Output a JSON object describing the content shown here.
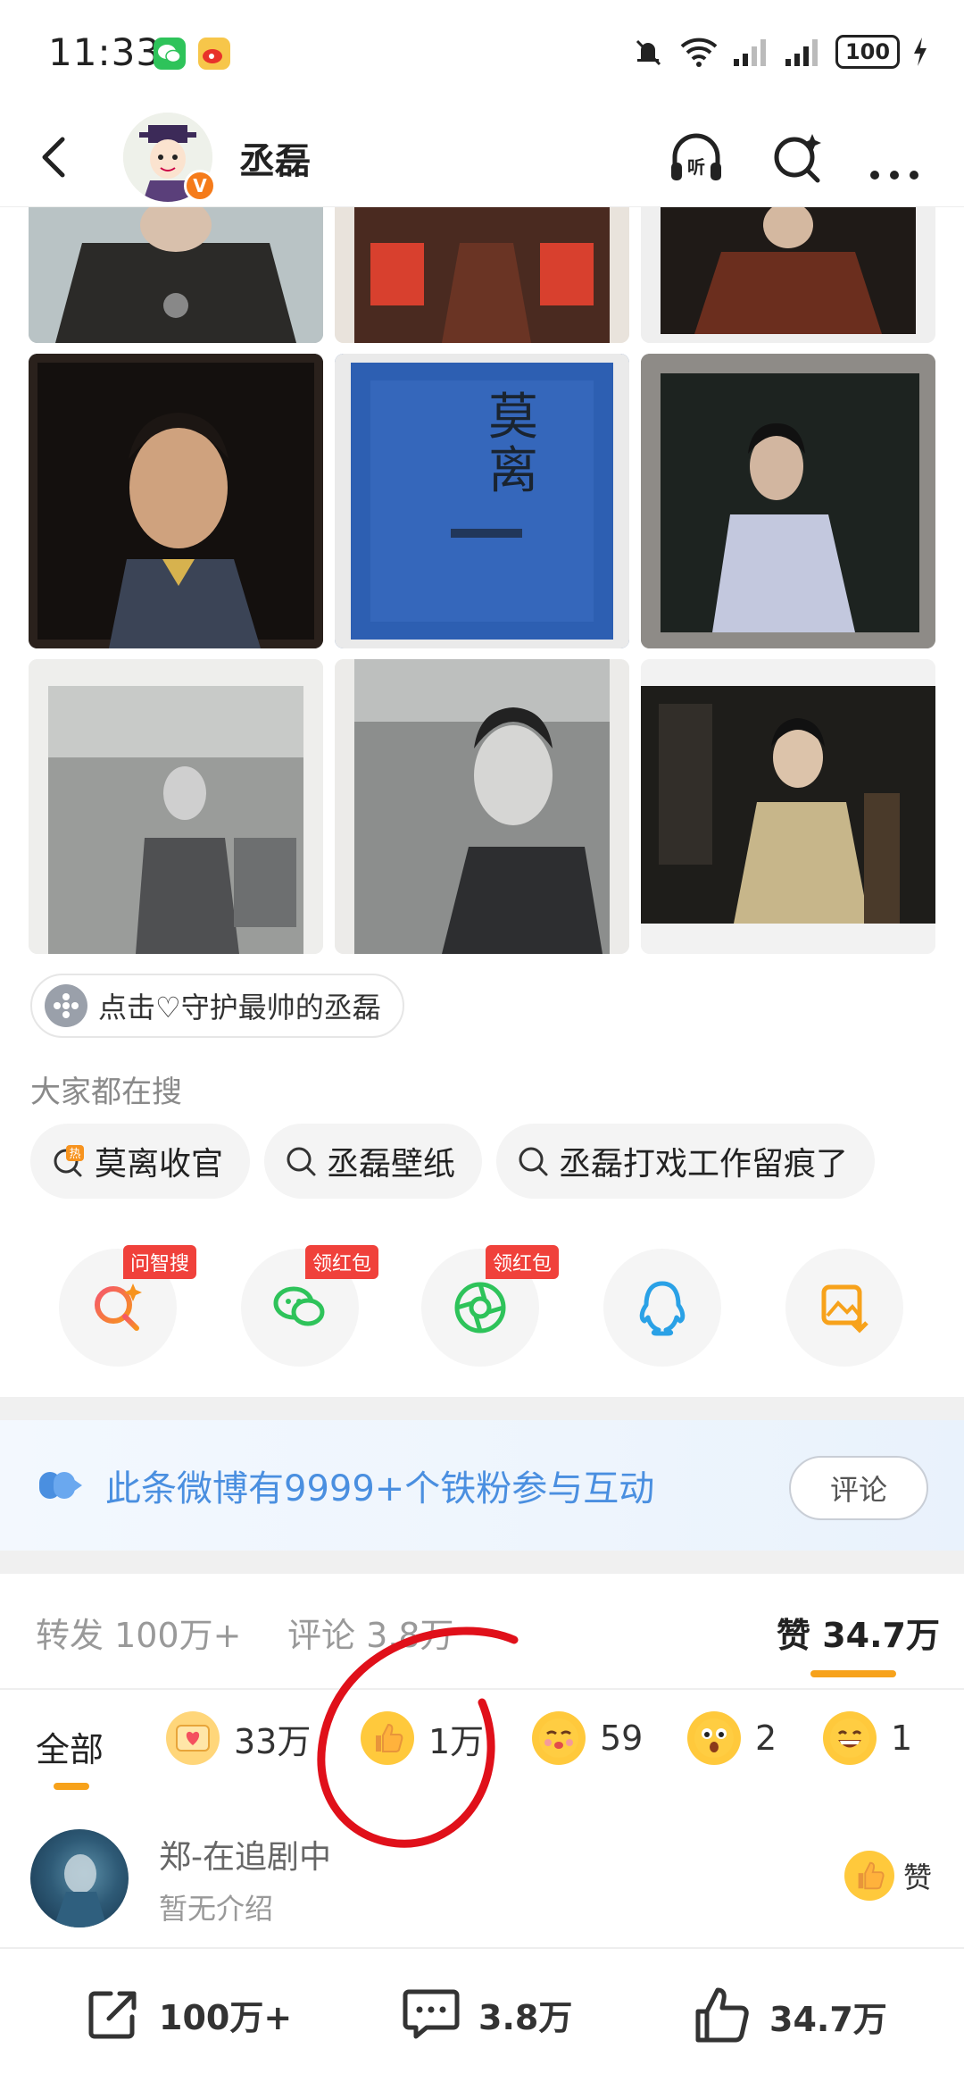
{
  "status_bar": {
    "time": "11:33",
    "battery": "100"
  },
  "header": {
    "name": "丞磊",
    "verified_badge": "V",
    "listen_label": "听"
  },
  "protect_chip": {
    "label": "点击♡守护最帅的丞磊"
  },
  "searches": {
    "title": "大家都在搜",
    "hot_tag": "热",
    "items": [
      "莫离收官",
      "丞磊壁纸",
      "丞磊打戏工作留痕了"
    ]
  },
  "share": {
    "items": [
      {
        "name": "zhi-search",
        "tag": "问智搜"
      },
      {
        "name": "wechat",
        "tag": "领红包"
      },
      {
        "name": "moments",
        "tag": "领红包"
      },
      {
        "name": "qq",
        "tag": ""
      },
      {
        "name": "save-image",
        "tag": ""
      }
    ]
  },
  "fans_banner": {
    "text": "此条微博有9999+个铁粉参与互动",
    "button": "评论"
  },
  "stats": {
    "repost": "转发 100万+",
    "comments": "评论 3.8万",
    "likes": "赞 34.7万"
  },
  "reactions": {
    "all_label": "全部",
    "items": [
      {
        "emoji": "heart-envelope",
        "count": "33万"
      },
      {
        "emoji": "thumbs-up",
        "count": "1万"
      },
      {
        "emoji": "kiss-face",
        "count": "59"
      },
      {
        "emoji": "surprised-face",
        "count": "2"
      },
      {
        "emoji": "grin-face",
        "count": "1"
      }
    ]
  },
  "liker": {
    "name": "郑-在追剧中",
    "bio": "暂无介绍",
    "like_label": "赞"
  },
  "bottom_bar": {
    "repost": "100万+",
    "comments": "3.8万",
    "likes": "34.7万"
  },
  "colors": {
    "accent": "#f7a21b",
    "link_blue": "#4a8fe0",
    "annotation_red": "#e0101a"
  }
}
